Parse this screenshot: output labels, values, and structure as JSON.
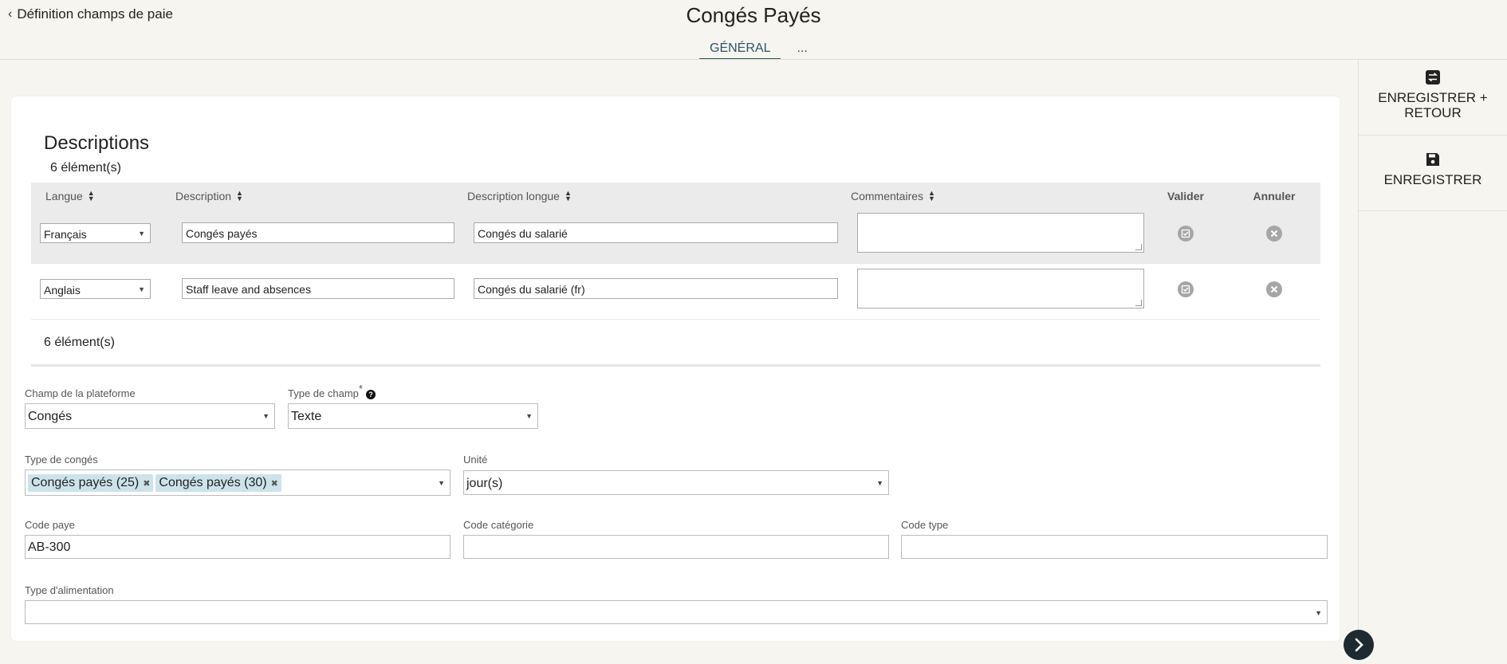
{
  "header": {
    "back_label": "Définition champs de paie",
    "title": "Congés Payés",
    "tabs": [
      {
        "label": "GÉNÉRAL"
      },
      {
        "label": "..."
      }
    ]
  },
  "actions": {
    "save_return": "ENREGISTRER + RETOUR",
    "save": "ENREGISTRER"
  },
  "descriptions": {
    "title": "Descriptions",
    "count_top": "6 élément(s)",
    "count_bottom": "6 élément(s)",
    "columns": {
      "langue": "Langue",
      "description": "Description",
      "description_longue": "Description longue",
      "commentaires": "Commentaires",
      "valider": "Valider",
      "annuler": "Annuler"
    },
    "rows": [
      {
        "langue": "Français",
        "description": "Congés payés",
        "description_longue": "Congés du salarié",
        "commentaires": ""
      },
      {
        "langue": "Anglais",
        "description": "Staff leave and absences",
        "description_longue": "Congés du salarié (fr)",
        "commentaires": ""
      }
    ]
  },
  "form": {
    "champ_plateforme": {
      "label": "Champ de la plateforme",
      "value": "Congés"
    },
    "type_champ": {
      "label": "Type de champ",
      "required_mark": "*",
      "help": "?",
      "value": "Texte"
    },
    "type_conges": {
      "label": "Type de congés",
      "chips": [
        "Congés payés (25)",
        "Congés payés (30)"
      ]
    },
    "unite": {
      "label": "Unité",
      "value": "jour(s)"
    },
    "code_paye": {
      "label": "Code paye",
      "value": "AB-300"
    },
    "code_categorie": {
      "label": "Code catégorie",
      "value": ""
    },
    "code_type": {
      "label": "Code type",
      "value": ""
    },
    "type_alimentation": {
      "label": "Type d'alimentation",
      "value": ""
    }
  },
  "colors": {
    "accent": "#2d5566",
    "chip": "#cde3ea",
    "header_row": "#ebebeb"
  }
}
